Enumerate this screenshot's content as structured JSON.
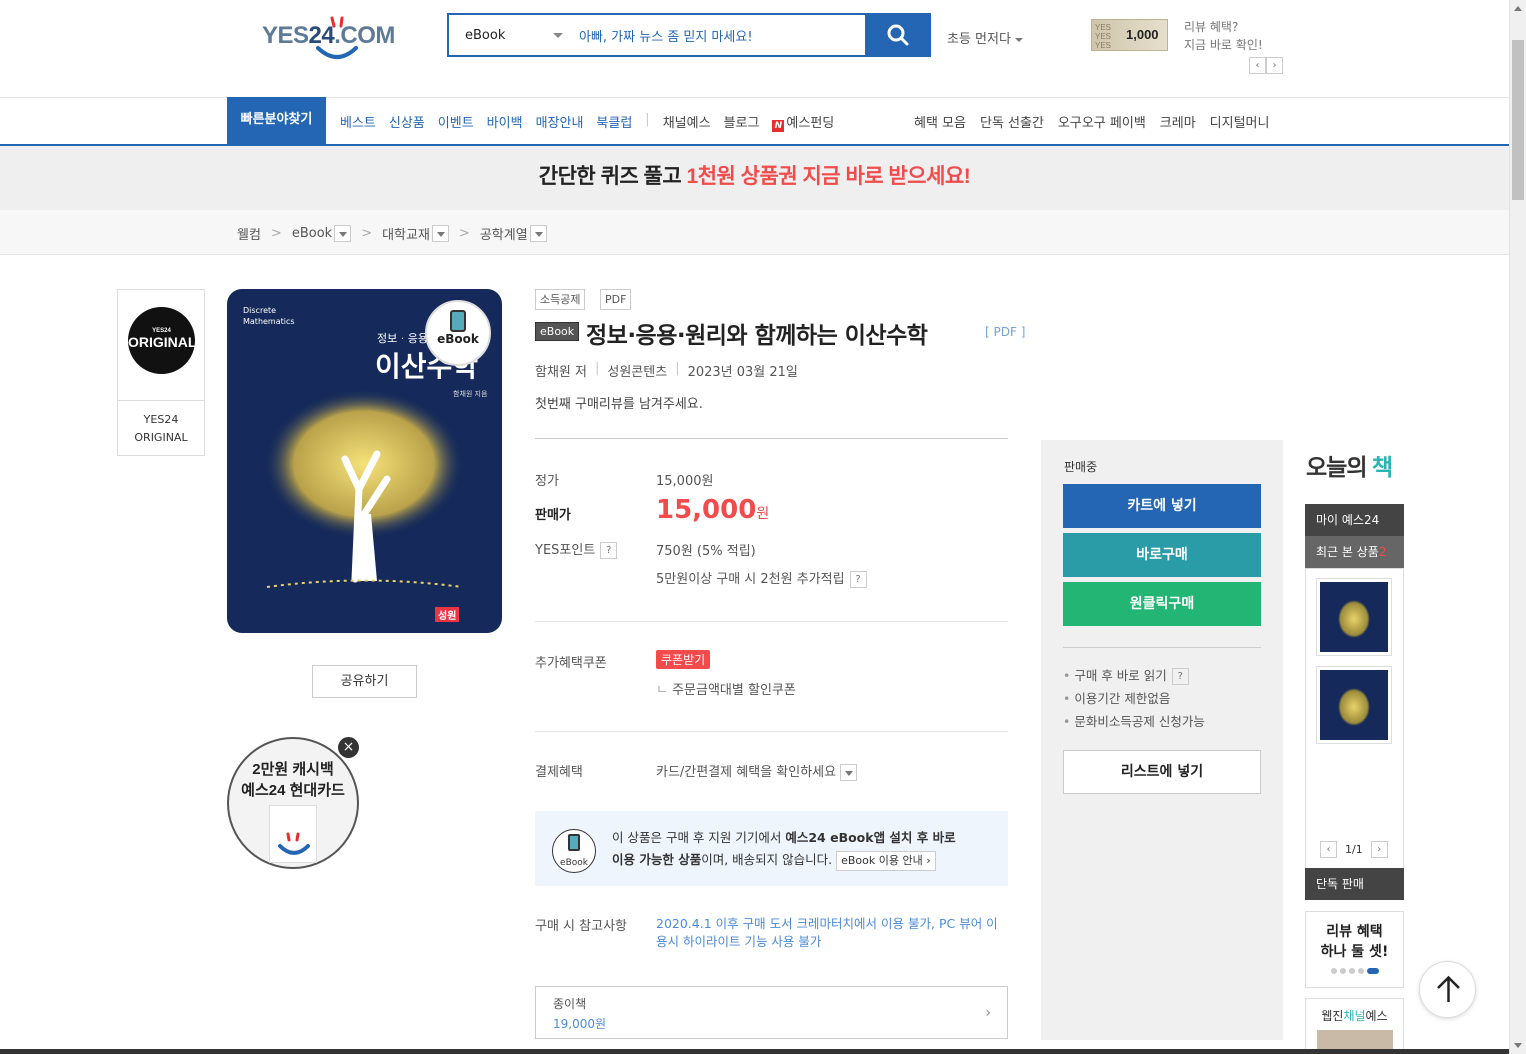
{
  "header": {
    "logo": "YES24.COM",
    "search": {
      "category": "eBook",
      "query": "아빠, 가짜 뉴스 좀 믿지 마세요!"
    },
    "sort_label": "초등 먼저다",
    "voucher_amount": "1,000",
    "review_promo": [
      "리뷰 혜택?",
      "지금 바로 확인!"
    ]
  },
  "nav": {
    "quick_find": "빠른분야찾기",
    "left_items": [
      "베스트",
      "신상품",
      "이벤트",
      "바이백",
      "매장안내",
      "북클럽"
    ],
    "mid_items": [
      "채널예스",
      "블로그",
      "예스펀딩"
    ],
    "right_items": [
      "혜택 모음",
      "단독 선출간",
      "오구오구 페이백",
      "크레마",
      "디지털머니"
    ]
  },
  "banner": {
    "part1": "간단한 퀴즈 풀고 ",
    "part2": "1천원 상품권 지금 바로 받으세요!"
  },
  "breadcrumb": [
    "웰컴",
    "eBook",
    "대학교재",
    "공학계열"
  ],
  "side_badge": {
    "circle_small": "YES24",
    "circle_text": "ORIGINAL",
    "label_line1": "YES24",
    "label_line2": "ORIGINAL"
  },
  "cover": {
    "en_title_1": "Discrete",
    "en_title_2": "Mathematics",
    "subtitle": "정보 · 응용 · 원",
    "title": "이산수학",
    "author": "함채원 지음",
    "publisher": "성원",
    "badge": "eBook"
  },
  "share_label": "공유하기",
  "cashcard": {
    "line1": "2만원 캐시백",
    "line2": "예스24 현대카드",
    "close": "×"
  },
  "product": {
    "tags": [
      "소득공제",
      "PDF"
    ],
    "ebook_tag": "eBook",
    "title": "정보·응용·원리와 함께하는 이산수학",
    "format": "[ PDF ]",
    "author": "함채원 저",
    "publisher": "성원콘텐츠",
    "date": "2023년 03월 21일",
    "first_review": "첫번째 구매리뷰를 남겨주세요.",
    "list_price_label": "정가",
    "list_price": "15,000원",
    "sale_price_label": "판매가",
    "sale_price": "15,000",
    "sale_price_unit": "원",
    "points_label": "YES포인트",
    "points": "750원 (5% 적립)",
    "points_extra": "5만원이상 구매 시 2천원 추가적립",
    "coupon_label": "추가혜택쿠폰",
    "coupon_button": "쿠폰받기",
    "coupon_detail": "주문금액대별 할인쿠폰",
    "payment_label": "결제혜택",
    "payment_detail": "카드/간편결제 혜택을 확인하세요",
    "notice_icon": "eBook",
    "notice_pre": "이 상품은 구매 후 지원 기기에서 ",
    "notice_bold1": "예스24 eBook앱 설치 후 바로",
    "notice_bold2": "이용 가능한 상품",
    "notice_post": "이며, 배송되지 않습니다.",
    "notice_guide": "eBook 이용 안내",
    "ref_label": "구매 시 참고사항",
    "ref_text": "2020.4.1 이후 구매 도서 크레마터치에서 이용 불가, PC 뷰어 이용시 하이라이트 기능 사용 불가",
    "paper_label": "종이책",
    "paper_price": "19,000원"
  },
  "panel": {
    "status": "판매중",
    "cart": "카트에 넣기",
    "buy_now": "바로구매",
    "one_click": "원클릭구매",
    "bullets": [
      "구매 후 바로 읽기",
      "이용기간 제한없음",
      "문화비소득공제 신청가능"
    ],
    "wishlist": "리스트에 넣기"
  },
  "sidebar": {
    "today_book_1": "오늘의 ",
    "today_book_2": "책",
    "my_yes24": "마이 예스24",
    "recent": "최근 본 상품",
    "recent_count": "2",
    "pager": "1/1",
    "exclusive": "단독 판매",
    "review_benefit_1": "리뷰 혜택",
    "review_benefit_2": "하나 둘 셋!",
    "webzine_1": "웹진",
    "webzine_2": "채널",
    "webzine_3": "예스"
  },
  "colors": {
    "brand_blue": "#2466b3",
    "accent_red": "#f24b4b",
    "teal": "#2a9ca8",
    "green": "#22b573"
  }
}
